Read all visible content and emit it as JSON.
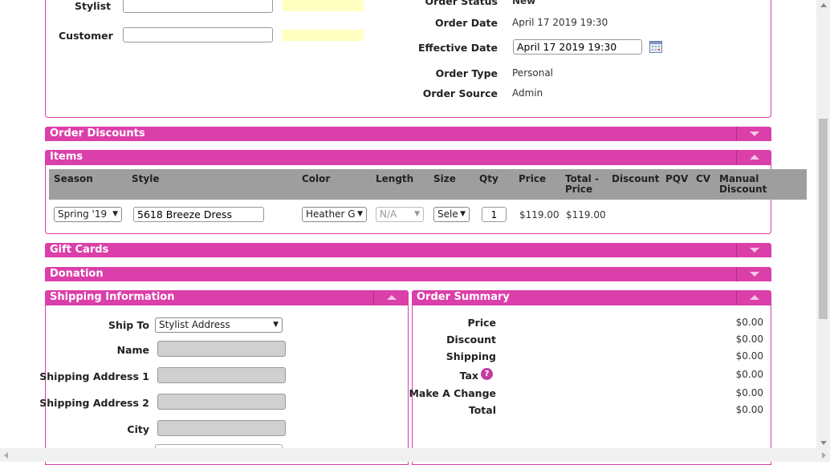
{
  "customer_panel": {
    "stylist_label": "Stylist",
    "customer_label": "Customer",
    "stylist_value": "",
    "customer_value": ""
  },
  "order_info": {
    "status_label": "Order Status",
    "status_value": "New",
    "date_label": "Order Date",
    "date_value": "April 17 2019 19:30",
    "effective_label": "Effective Date",
    "effective_value": "April 17 2019 19:30",
    "type_label": "Order Type",
    "type_value": "Personal",
    "source_label": "Order Source",
    "source_value": "Admin"
  },
  "sections": {
    "discounts": "Order Discounts",
    "items": "Items",
    "gift_cards": "Gift Cards",
    "donation": "Donation",
    "shipping": "Shipping Information",
    "summary": "Order Summary"
  },
  "items_table": {
    "headers": {
      "season": "Season",
      "style": "Style",
      "color": "Color",
      "length": "Length",
      "size": "Size",
      "qty": "Qty",
      "price": "Price",
      "total_price": "Total -\nPrice",
      "discount": "Discount",
      "pqv": "PQV",
      "cv": "CV",
      "manual_discount": "Manual\nDiscount"
    },
    "row": {
      "season": "Spring '19",
      "style": "5618 Breeze Dress",
      "color": "Heather G",
      "length": "N/A",
      "size": "Sele",
      "qty": "1",
      "price": "$119.00",
      "total": "$119.00"
    }
  },
  "shipping": {
    "ship_to_label": "Ship To",
    "ship_to_value": "Stylist Address",
    "name_label": "Name",
    "addr1_label": "Shipping Address 1",
    "addr2_label": "Shipping Address 2",
    "city_label": "City"
  },
  "summary": {
    "price_label": "Price",
    "price_value": "$0.00",
    "discount_label": "Discount",
    "discount_value": "$0.00",
    "shipping_label": "Shipping",
    "shipping_value": "$0.00",
    "tax_label": "Tax",
    "tax_help": "?",
    "tax_value": "$0.00",
    "change_label": "Make A Change",
    "change_value": "$0.00",
    "total_label": "Total",
    "total_value": "$0.00"
  },
  "colors": {
    "accent": "#db3fa9",
    "header_grey": "#9e9e9e",
    "highlight_yellow": "#ffffc2"
  }
}
